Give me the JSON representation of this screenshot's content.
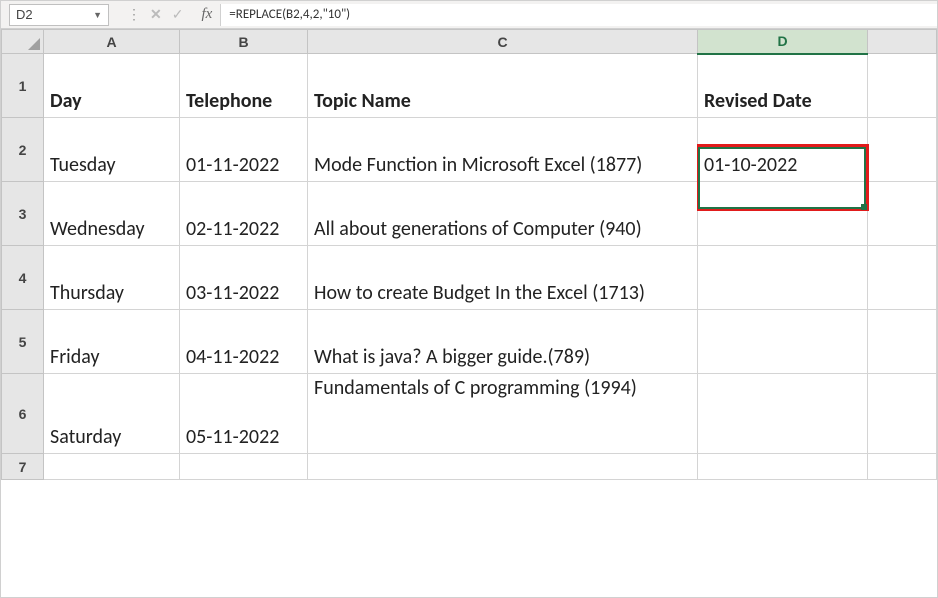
{
  "nameBox": "D2",
  "formulaBar": "=REPLACE(B2,4,2,\"10\")",
  "columnHeaders": {
    "A": "A",
    "B": "B",
    "C": "C",
    "D": "D"
  },
  "rowNumbers": {
    "r1": "1",
    "r2": "2",
    "r3": "3",
    "r4": "4",
    "r5": "5",
    "r6": "6",
    "r7": "7"
  },
  "headers": {
    "A": "Day",
    "B": "Telephone",
    "C": "Topic Name",
    "D": "Revised Date"
  },
  "rows": {
    "r2": {
      "A": "Tuesday",
      "B": "01-11-2022",
      "C": "Mode Function in Microsoft Excel (1877)",
      "D": "01-10-2022"
    },
    "r3": {
      "A": "Wednesday",
      "B": "02-11-2022",
      "C": "All about generations of Computer (940)",
      "D": ""
    },
    "r4": {
      "A": "Thursday",
      "B": "03-11-2022",
      "C": "How to create Budget In the Excel (1713)",
      "D": ""
    },
    "r5": {
      "A": "Friday",
      "B": "04-11-2022",
      "C": "What is java? A bigger guide.(789)",
      "D": ""
    },
    "r6": {
      "A": "Saturday",
      "B": "05-11-2022",
      "C": "Fundamentals of C programming (1994)",
      "D": ""
    }
  },
  "chart_data": {
    "type": "table",
    "title": "",
    "columns": [
      "Day",
      "Telephone",
      "Topic Name",
      "Revised Date"
    ],
    "rows": [
      [
        "Tuesday",
        "01-11-2022",
        "Mode Function in Microsoft Excel (1877)",
        "01-10-2022"
      ],
      [
        "Wednesday",
        "02-11-2022",
        "All about generations of Computer (940)",
        ""
      ],
      [
        "Thursday",
        "03-11-2022",
        "How to create Budget In the Excel (1713)",
        ""
      ],
      [
        "Friday",
        "04-11-2022",
        "What is java? A bigger guide.(789)",
        ""
      ],
      [
        "Saturday",
        "05-11-2022",
        "Fundamentals of C programming (1994)",
        ""
      ]
    ]
  }
}
